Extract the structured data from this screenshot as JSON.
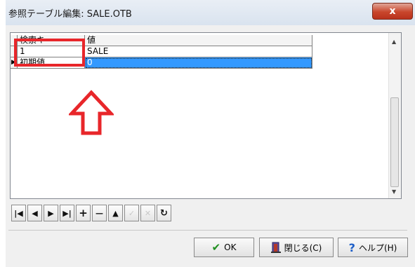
{
  "window": {
    "title": "参照テーブル編集: SALE.OTB",
    "close_label": "x"
  },
  "grid": {
    "columns": [
      "検索キー",
      "値"
    ],
    "rows": [
      {
        "indicator": "",
        "key": "1",
        "value": "SALE"
      },
      {
        "indicator": "▶",
        "key": "初期値",
        "value": "0"
      }
    ]
  },
  "navigator": {
    "buttons": [
      {
        "name": "first",
        "glyph": "|◀",
        "enabled": true
      },
      {
        "name": "prior",
        "glyph": "◀",
        "enabled": true
      },
      {
        "name": "next",
        "glyph": "▶",
        "enabled": true
      },
      {
        "name": "last",
        "glyph": "▶|",
        "enabled": true
      },
      {
        "name": "insert",
        "glyph": "+",
        "enabled": true
      },
      {
        "name": "delete",
        "glyph": "—",
        "enabled": true
      },
      {
        "name": "edit",
        "glyph": "▲",
        "enabled": true
      },
      {
        "name": "post",
        "glyph": "✓",
        "enabled": false
      },
      {
        "name": "cancel",
        "glyph": "✕",
        "enabled": false
      },
      {
        "name": "refresh",
        "glyph": "↻",
        "enabled": true
      }
    ]
  },
  "buttons": {
    "ok": "OK",
    "close": "閉じる(C)",
    "help": "ヘルプ(H)"
  },
  "colors": {
    "selection": "#3399ff",
    "annotation": "#e8262a"
  }
}
